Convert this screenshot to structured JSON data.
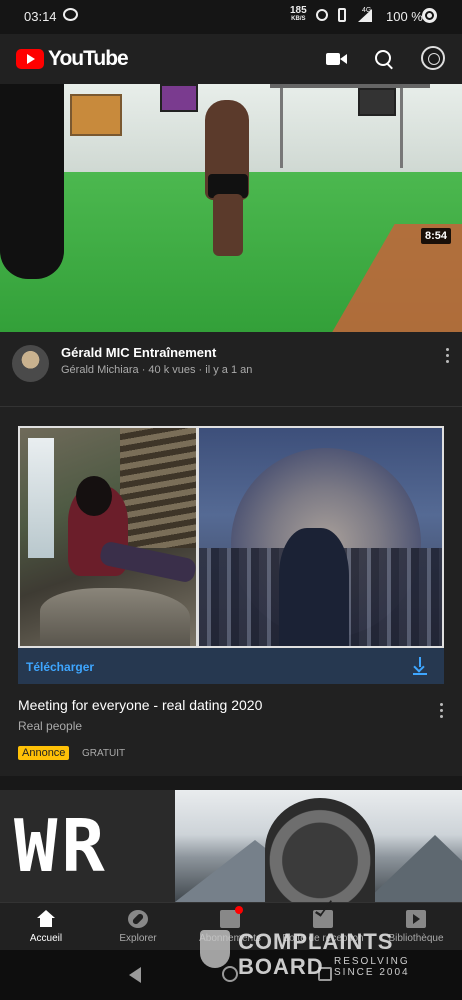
{
  "status_bar": {
    "time": "03:14",
    "net_speed": "185",
    "net_unit": "KB/S",
    "lte_label": "4G",
    "battery": "100 %"
  },
  "app_bar": {
    "brand": "YouTube",
    "icons": [
      "video-camera-icon",
      "search-icon",
      "account-avatar"
    ]
  },
  "video": {
    "duration": "8:54",
    "title": "Gérald MIC Entraînement",
    "meta": "Gérald Michiara · 40 k vues · il y a 1 an"
  },
  "ad": {
    "cta": "Télécharger",
    "title": "Meeting for everyone - real dating 2020",
    "advertiser": "Real people",
    "badge": "Annonce",
    "price": "GRATUIT"
  },
  "next_item": {
    "thumb_text": "WR"
  },
  "bottom_nav": {
    "items": [
      {
        "label": "Accueil",
        "icon": "home-icon",
        "active": true
      },
      {
        "label": "Explorer",
        "icon": "explore-icon",
        "active": false
      },
      {
        "label": "Abonnements",
        "icon": "subscriptions-icon",
        "active": false
      },
      {
        "label": "Boîte de réception",
        "icon": "inbox-icon",
        "active": false
      },
      {
        "label": "Bibliothèque",
        "icon": "library-icon",
        "active": false
      }
    ]
  },
  "watermark": {
    "line1": "COMPLAINTS",
    "line2": "BOARD",
    "tag1": "RESOLVING",
    "tag2": "SINCE 2004"
  },
  "colors": {
    "background": "#212121",
    "accent_blue": "#3ea6ff",
    "brand_red": "#ff0000",
    "badge_yellow": "#ffc107"
  }
}
